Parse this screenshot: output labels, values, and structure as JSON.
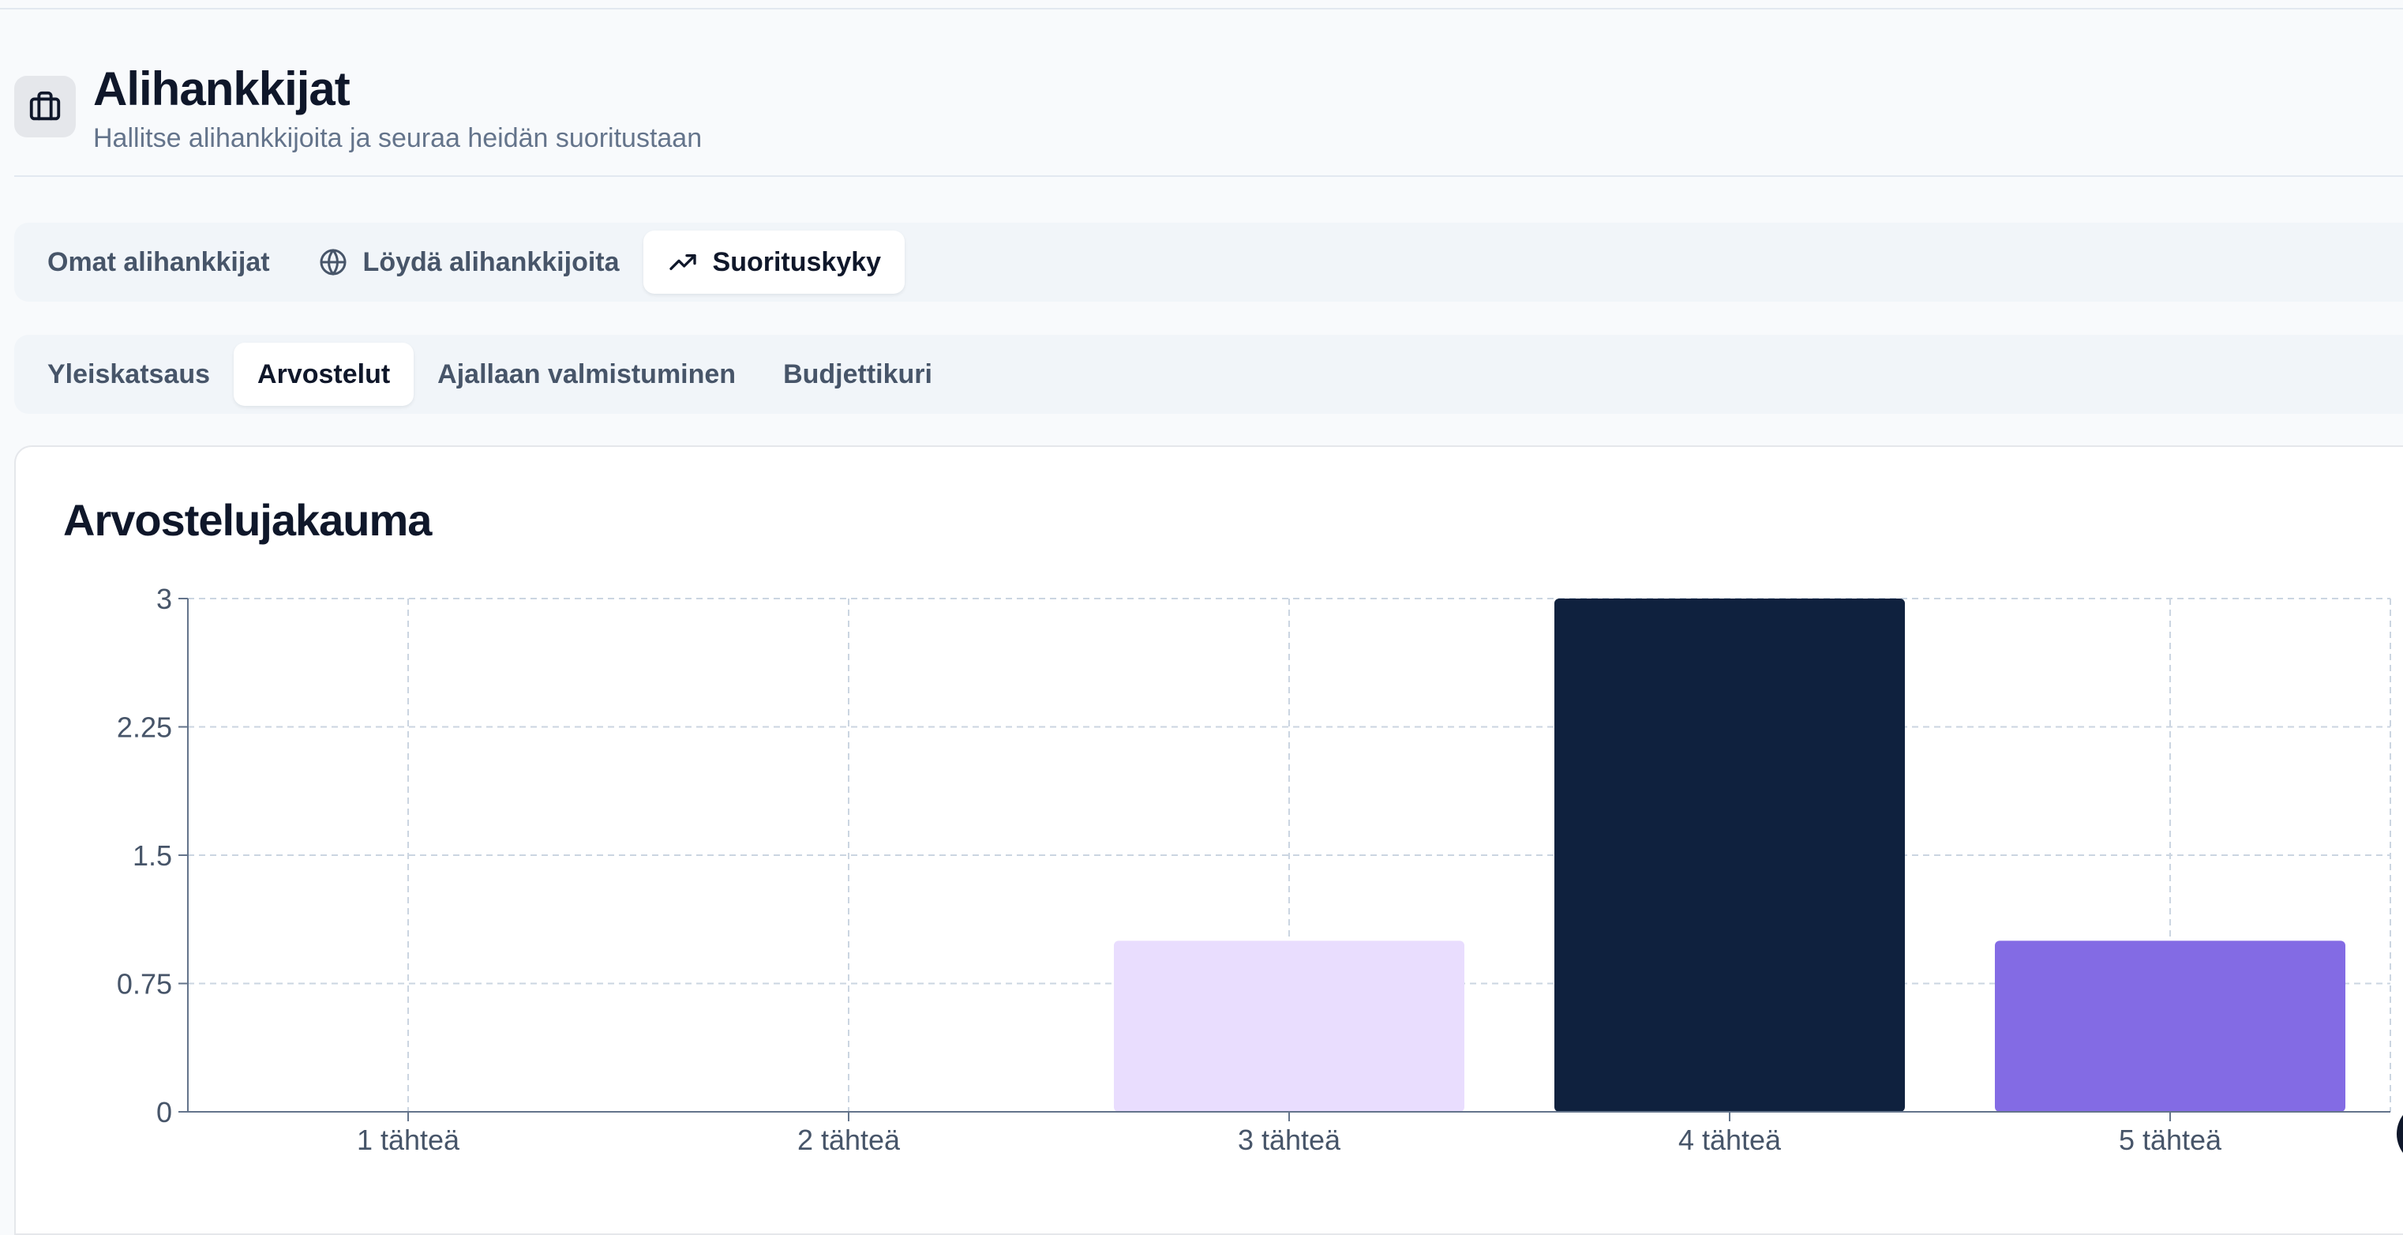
{
  "header": {
    "title": "Alihankkijat",
    "subtitle": "Hallitse alihankkijoita ja seuraa heidän suoritustaan",
    "icon": "briefcase-icon"
  },
  "main_tabs": [
    {
      "label": "Omat alihankkijat",
      "icon": "",
      "active": false
    },
    {
      "label": "Löydä alihankkijoita",
      "icon": "globe-icon",
      "active": false
    },
    {
      "label": "Suorituskyky",
      "icon": "trending-up-icon",
      "active": true
    }
  ],
  "sub_tabs": [
    {
      "label": "Yleiskatsaus",
      "active": false
    },
    {
      "label": "Arvostelut",
      "active": true
    },
    {
      "label": "Ajallaan valmistuminen",
      "active": false
    },
    {
      "label": "Budjettikuri",
      "active": false
    }
  ],
  "card": {
    "title": "Arvostelujakauma"
  },
  "chart_data": {
    "type": "bar",
    "title": "Arvostelujakauma",
    "categories": [
      "1 tähteä",
      "2 tähteä",
      "3 tähteä",
      "4 tähteä",
      "5 tähteä"
    ],
    "values": [
      0,
      0,
      1,
      3,
      1
    ],
    "bar_colors": [
      "#e9ddfe",
      "#e9ddfe",
      "#e9ddfe",
      "#0f213e",
      "#836be4"
    ],
    "ylim": [
      0,
      3
    ],
    "yticks": [
      "0",
      "0.75",
      "1.5",
      "2.25",
      "3"
    ],
    "grid": true,
    "xlabel": "",
    "ylabel": ""
  },
  "colors": {
    "text_primary": "#0f172a",
    "text_muted": "#64748b",
    "tab_bg": "#f1f5f9",
    "grid": "#cbd5e1"
  }
}
